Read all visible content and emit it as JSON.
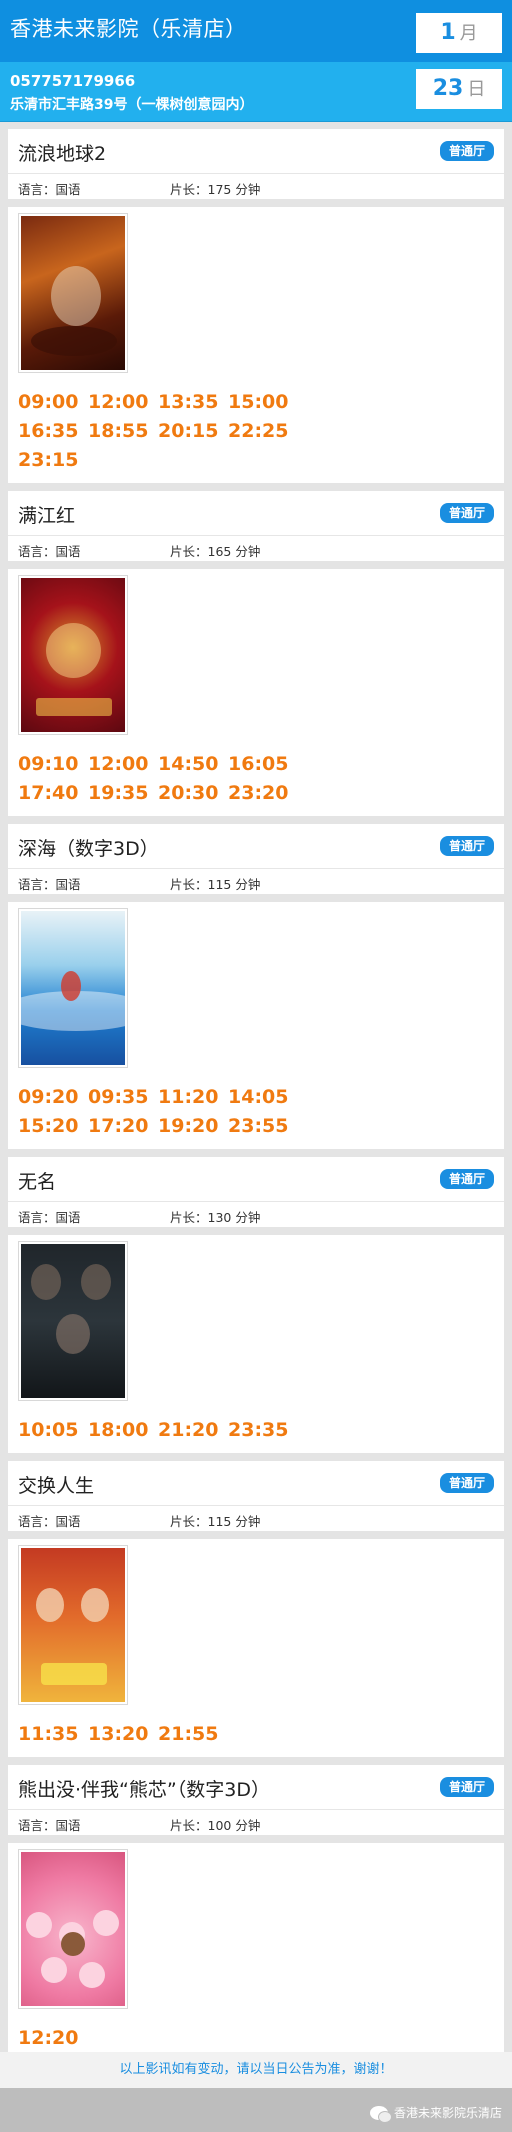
{
  "header": {
    "cinema_name": "香港未来影院（乐清店）",
    "phone": "057757179966",
    "address": "乐清市汇丰路39号（一棵树创意园内）",
    "month": "1",
    "month_unit": "月",
    "day": "23",
    "day_unit": "日"
  },
  "movies": [
    {
      "title": "流浪地球2",
      "hall": "普通厅",
      "language": "语言：国语",
      "duration": "片长：175 分钟",
      "times": [
        "09:00",
        "12:00",
        "13:35",
        "15:00",
        "16:35",
        "18:55",
        "20:15",
        "22:25",
        "23:15"
      ]
    },
    {
      "title": "满江红",
      "hall": "普通厅",
      "language": "语言：国语",
      "duration": "片长：165 分钟",
      "times": [
        "09:10",
        "12:00",
        "14:50",
        "16:05",
        "17:40",
        "19:35",
        "20:30",
        "23:20"
      ]
    },
    {
      "title": "深海（数字3D）",
      "hall": "普通厅",
      "language": "语言：国语",
      "duration": "片长：115 分钟",
      "times": [
        "09:20",
        "09:35",
        "11:20",
        "14:05",
        "15:20",
        "17:20",
        "19:20",
        "23:55"
      ]
    },
    {
      "title": "无名",
      "hall": "普通厅",
      "language": "语言：国语",
      "duration": "片长：130 分钟",
      "times": [
        "10:05",
        "18:00",
        "21:20",
        "23:35"
      ]
    },
    {
      "title": "交换人生",
      "hall": "普通厅",
      "language": "语言：国语",
      "duration": "片长：115 分钟",
      "times": [
        "11:35",
        "13:20",
        "21:55"
      ]
    },
    {
      "title": "熊出没·伴我“熊芯”（数字3D）",
      "hall": "普通厅",
      "language": "语言：国语",
      "duration": "片长：100 分钟",
      "times": [
        "12:20"
      ]
    }
  ],
  "footer": {
    "notice": "以上影讯如有变动，请以当日公告为准，谢谢！",
    "brand": "香港未来影院乐清店",
    "brand_icon": "wechat-icon"
  },
  "colors": {
    "header_dark": "#0f8fe0",
    "header_light": "#22b0ee",
    "accent": "#1a8ee0",
    "time_orange": "#f07a10"
  }
}
